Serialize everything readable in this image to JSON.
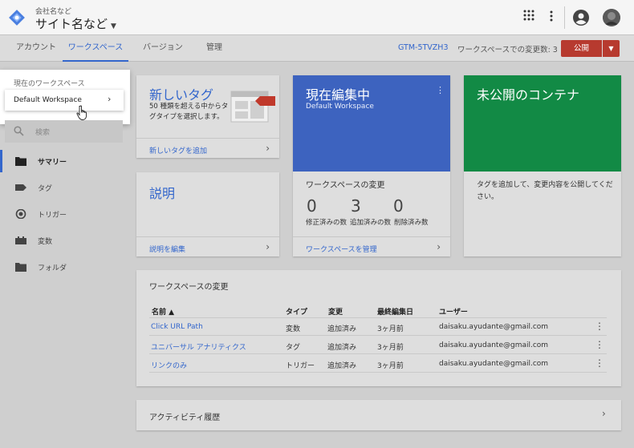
{
  "header": {
    "company": "会社名など",
    "site": "サイト名など"
  },
  "nav": {
    "tabs": [
      {
        "label": "アカウント"
      },
      {
        "label": "ワークスペース"
      },
      {
        "label": "バージョン"
      },
      {
        "label": "管理"
      }
    ],
    "container_id": "GTM-5TVZH3",
    "ws_changes": "ワークスペースでの変更数: 3",
    "publish_label": "公開"
  },
  "sidebar": {
    "ws_title": "現在のワークスペース",
    "ws_name": "Default Workspace",
    "search_label": "検索",
    "items": [
      {
        "label": "サマリー"
      },
      {
        "label": "タグ"
      },
      {
        "label": "トリガー"
      },
      {
        "label": "変数"
      },
      {
        "label": "フォルダ"
      }
    ]
  },
  "new_tag": {
    "title": "新しいタグ",
    "desc": "50 種類を超える中からタグタイプを選択します。",
    "link": "新しいタグを追加"
  },
  "description": {
    "title": "説明",
    "link": "説明を編集"
  },
  "editing": {
    "title": "現在編集中",
    "subtitle": "Default Workspace",
    "changes_label": "ワークスペースの変更",
    "modified": "0",
    "added": "3",
    "deleted": "0",
    "modified_label": "修正済みの数",
    "added_label": "追加済みの数",
    "deleted_label": "削除済み数",
    "link": "ワークスペースを管理"
  },
  "unpublished": {
    "title": "未公開のコンテナ",
    "body": "タグを追加して、変更内容を公開してください。"
  },
  "changes_table": {
    "title": "ワークスペースの変更",
    "headers": {
      "name": "名前 ▲",
      "type": "タイプ",
      "change": "変更",
      "edited": "最終編集日",
      "user": "ユーザー"
    },
    "rows": [
      {
        "name": "Click URL Path",
        "type": "変数",
        "change": "追加済み",
        "edited": "3ヶ月前",
        "user": "daisaku.ayudante@gmail.com"
      },
      {
        "name": "ユニバーサル アナリティクス",
        "type": "タグ",
        "change": "追加済み",
        "edited": "3ヶ月前",
        "user": "daisaku.ayudante@gmail.com"
      },
      {
        "name": "リンクのみ",
        "type": "トリガー",
        "change": "追加済み",
        "edited": "3ヶ月前",
        "user": "daisaku.ayudante@gmail.com"
      }
    ]
  },
  "activity": {
    "title": "アクティビティ履歴"
  },
  "colors": {
    "accent": "#3366cc",
    "publish": "#b73a2f",
    "editing": "#3d63bf",
    "unpublished": "#128a45"
  }
}
